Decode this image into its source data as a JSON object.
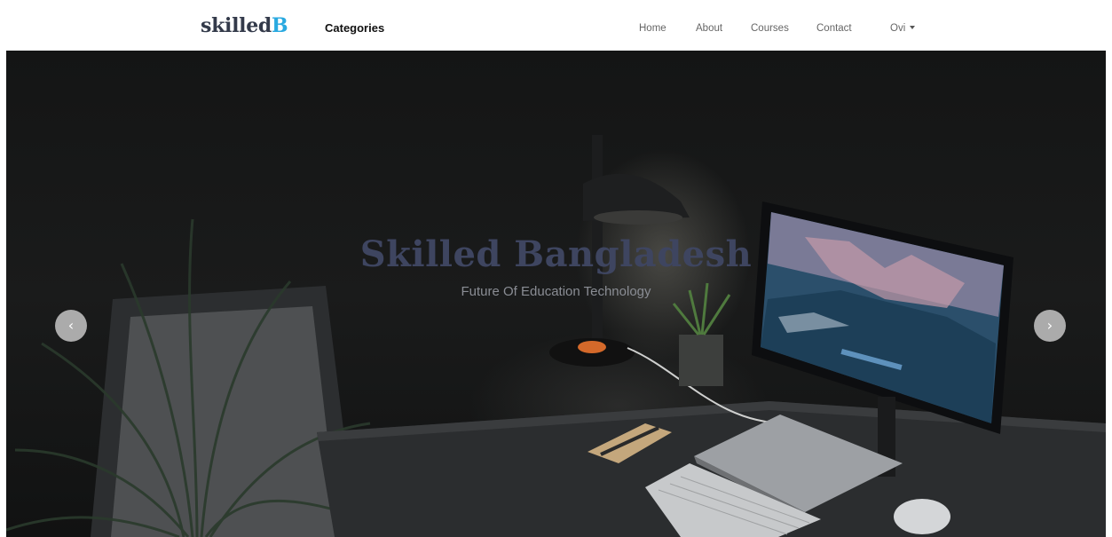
{
  "navbar": {
    "brand_main": "skilled",
    "brand_accent": "B",
    "categories_label": "Categories",
    "links": [
      "Home",
      "About",
      "Courses",
      "Contact"
    ],
    "user_menu_label": "Ovi"
  },
  "hero": {
    "title": "Skilled Bangladesh",
    "subtitle": "Future Of Education Technology",
    "prev_symbol": "‹",
    "next_symbol": "›"
  },
  "colors": {
    "brand_text": "#333a4a",
    "brand_accent": "#29a9e0",
    "hero_title": "#3e4560"
  },
  "icons": [
    "chevron-left-icon",
    "chevron-right-icon",
    "caret-down-icon"
  ]
}
